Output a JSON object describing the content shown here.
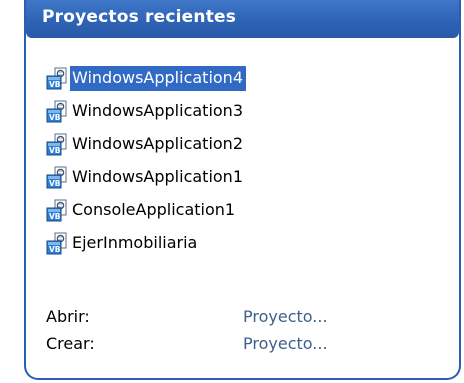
{
  "panel": {
    "title": "Proyectos recientes",
    "accent_color": "#2f63b6",
    "selection_color": "#316ac5",
    "link_color": "#3e5f8c"
  },
  "recent_projects": [
    {
      "label": "WindowsApplication4",
      "icon": "vb-project-icon",
      "selected": true
    },
    {
      "label": "WindowsApplication3",
      "icon": "vb-project-icon",
      "selected": false
    },
    {
      "label": "WindowsApplication2",
      "icon": "vb-project-icon",
      "selected": false
    },
    {
      "label": "WindowsApplication1",
      "icon": "vb-project-icon",
      "selected": false
    },
    {
      "label": "ConsoleApplication1",
      "icon": "vb-project-icon",
      "selected": false
    },
    {
      "label": "EjerInmobiliaria",
      "icon": "vb-project-icon",
      "selected": false
    }
  ],
  "actions": [
    {
      "label": "Abrir:",
      "link": "Proyecto..."
    },
    {
      "label": "Crear:",
      "link": "Proyecto..."
    }
  ]
}
